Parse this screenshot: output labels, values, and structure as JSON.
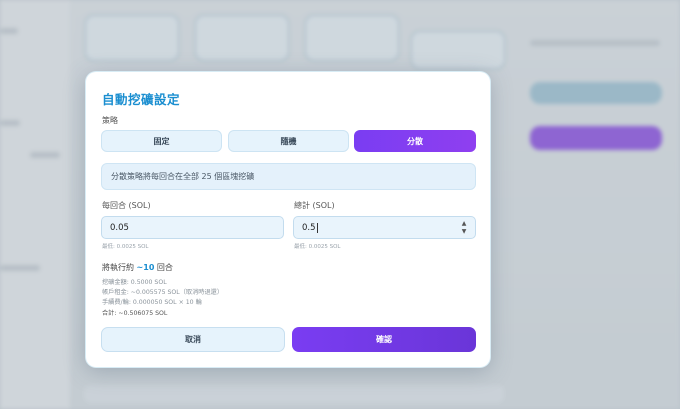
{
  "modal": {
    "title": "自動挖礦設定",
    "strategy_label": "策略",
    "strategies": [
      {
        "label": "固定",
        "active": false
      },
      {
        "label": "隨機",
        "active": false
      },
      {
        "label": "分散",
        "active": true
      }
    ],
    "info_text": "分散策略將每回合在全部 25 個區塊挖礦",
    "per_round": {
      "label": "每回合 (SOL)",
      "value": "0.05",
      "hint": "最低: 0.0025 SOL"
    },
    "total": {
      "label": "總計 (SOL)",
      "value": "0.5",
      "hint": "最低: 0.0025 SOL"
    },
    "execute": {
      "prefix": "將執行約 ",
      "rounds": "~10",
      "suffix": " 回合"
    },
    "details": {
      "mining_amount": "挖礦金額: 0.5000 SOL",
      "network_fee": "帳戶租金: ~0.005575 SOL（取消時退還）",
      "fee_per_round": "手續費/輪: 0.000050 SOL × 10 輪",
      "total": "合計: ~0.506075 SOL"
    },
    "cancel_label": "取消",
    "confirm_label": "確認"
  },
  "colors": {
    "accent_blue": "#1a8ed0",
    "accent_purple": "#7a3df2"
  }
}
